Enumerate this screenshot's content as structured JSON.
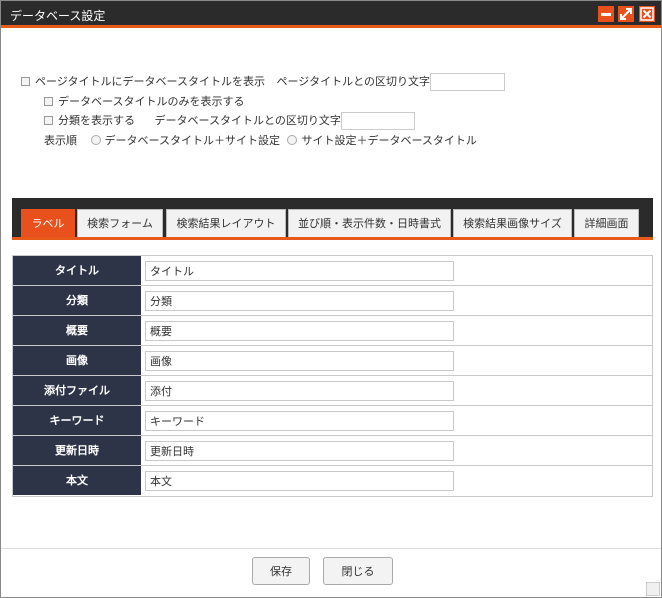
{
  "window": {
    "title": "データベース設定"
  },
  "options": {
    "show_db_title_label": "ページタイトルにデータベースタイトルを表示",
    "separator_label": "ページタイトルとの区切り文字",
    "separator_value": "",
    "only_db_title_label": "データベースタイトルのみを表示する",
    "show_category_label": "分類を表示する",
    "db_separator_label": "データベースタイトルとの区切り文字",
    "db_separator_value": "",
    "order_label": "表示順",
    "order_option_1": "データベースタイトル＋サイト設定",
    "order_option_2": "サイト設定＋データベースタイトル"
  },
  "tabs": [
    {
      "label": "ラベル",
      "active": true
    },
    {
      "label": "検索フォーム"
    },
    {
      "label": "検索結果レイアウト"
    },
    {
      "label": "並び順・表示件数・日時書式"
    },
    {
      "label": "検索結果画像サイズ"
    },
    {
      "label": "詳細画面"
    }
  ],
  "fields": [
    {
      "label": "タイトル",
      "value": "タイトル"
    },
    {
      "label": "分類",
      "value": "分類"
    },
    {
      "label": "概要",
      "value": "概要"
    },
    {
      "label": "画像",
      "value": "画像"
    },
    {
      "label": "添付ファイル",
      "value": "添付"
    },
    {
      "label": "キーワード",
      "value": "キーワード"
    },
    {
      "label": "更新日時",
      "value": "更新日時"
    },
    {
      "label": "本文",
      "value": "本文"
    }
  ],
  "footer": {
    "save_label": "保存",
    "close_label": "閉じる"
  },
  "colors": {
    "accent": "#e8501c",
    "titlebar": "#2b2b2b",
    "label_bg": "#2d3447"
  }
}
